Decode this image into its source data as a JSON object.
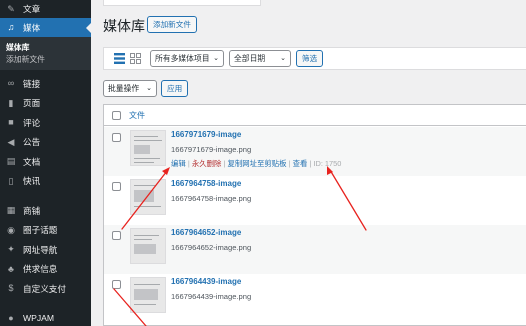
{
  "sidebar": {
    "items_top": [
      {
        "label": "文章",
        "icon": "pin-icon"
      },
      {
        "label": "媒体",
        "icon": "media-icon",
        "active": true
      }
    ],
    "submenu": [
      {
        "label": "媒体库",
        "current": true
      },
      {
        "label": "添加新文件",
        "current": false
      }
    ],
    "items_mid": [
      {
        "label": "链接",
        "icon": "link-icon"
      },
      {
        "label": "页面",
        "icon": "page-icon"
      },
      {
        "label": "评论",
        "icon": "comment-icon"
      },
      {
        "label": "公告",
        "icon": "megaphone-icon"
      },
      {
        "label": "文档",
        "icon": "document-icon"
      },
      {
        "label": "快讯",
        "icon": "flash-icon"
      }
    ],
    "items_bottom": [
      {
        "label": "商铺",
        "icon": "store-icon"
      },
      {
        "label": "圈子话题",
        "icon": "circle-icon"
      },
      {
        "label": "网址导航",
        "icon": "compass-icon"
      },
      {
        "label": "供求信息",
        "icon": "supply-icon"
      },
      {
        "label": "自定义支付",
        "icon": "pay-icon"
      }
    ],
    "items_last": [
      {
        "label": "WPJAM",
        "icon": "wpjam-icon"
      }
    ]
  },
  "header": {
    "title": "媒体库",
    "add_label": "添加新文件"
  },
  "filters": {
    "media_type": "所有多媒体项目",
    "date": "全部日期",
    "filter_label": "筛选"
  },
  "bulk": {
    "select_label": "批量操作",
    "apply_label": "应用"
  },
  "table": {
    "column_file": "文件",
    "rows": [
      {
        "title": "1667971679-image",
        "filename": "1667971679-image.png",
        "actions": {
          "edit": "编辑",
          "delete": "永久删除",
          "copy": "复制网址至剪贴板",
          "view": "查看",
          "id": "ID: 1750"
        }
      },
      {
        "title": "1667964758-image",
        "filename": "1667964758-image.png"
      },
      {
        "title": "1667964652-image",
        "filename": "1667964652-image.png"
      },
      {
        "title": "1667964439-image",
        "filename": "1667964439-image.png"
      }
    ]
  },
  "colors": {
    "sidebar_bg": "#1d2327",
    "active_bg": "#2271b1",
    "link": "#2271b1",
    "delete": "#b32d2e",
    "arrow": "#e8231f"
  }
}
